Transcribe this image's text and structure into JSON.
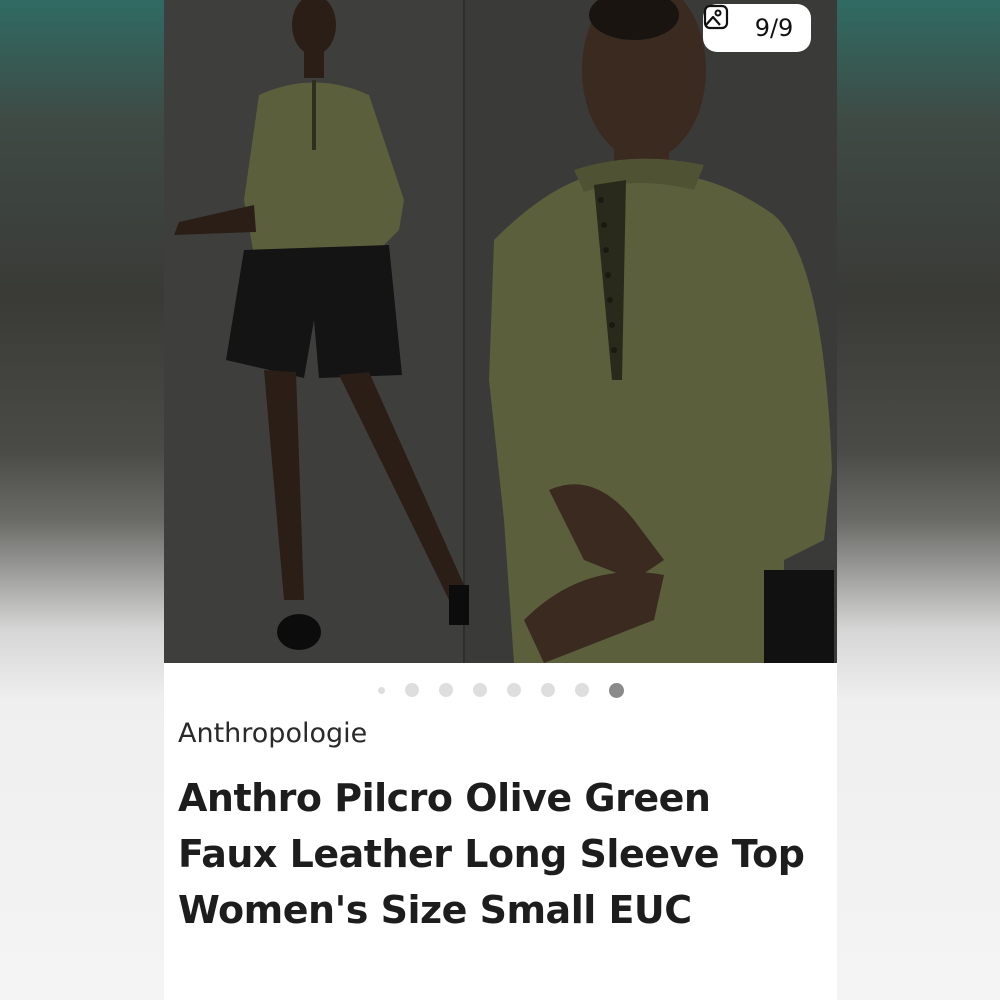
{
  "image_counter": {
    "text": "9/9",
    "icon": "image-icon"
  },
  "carousel": {
    "total_dots": 8,
    "active_index": 7
  },
  "listing": {
    "brand": "Anthropologie",
    "title": "Anthro Pilcro Olive Green Faux Leather Long Sleeve Top Women's Size Small EUC"
  },
  "colors": {
    "olive_top": "#5b5f3c",
    "photo_background": "#3b3b3a",
    "counter_background": "#ffffff",
    "active_dot": "#8a8a8a",
    "inactive_dot": "#dedede"
  }
}
